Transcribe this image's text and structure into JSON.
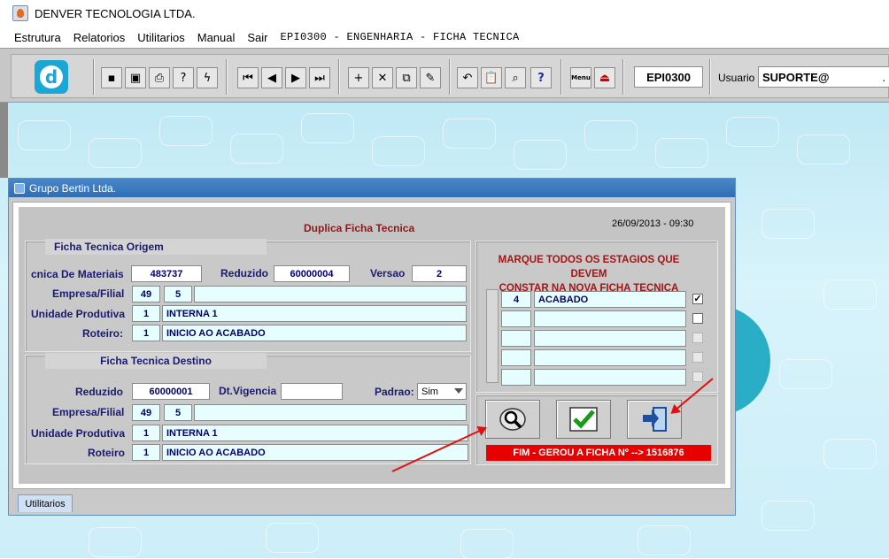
{
  "window": {
    "title": "DENVER TECNOLOGIA LTDA."
  },
  "menu": {
    "items": [
      "Estrutura",
      "Relatorios",
      "Utilitarios",
      "Manual",
      "Sair"
    ],
    "form_caption": "EPI0300 - ENGENHARIA - FICHA TECNICA"
  },
  "toolbar": {
    "form_code": "EPI0300",
    "user_label": "Usuario",
    "user_value": "SUPORTE@",
    "user_suffix": ".",
    "menu_icon_label": "Menu"
  },
  "inner_window": {
    "title": "Grupo Bertin Ltda.",
    "tab_label": "Utilitarios"
  },
  "form": {
    "heading": "Duplica Ficha Tecnica",
    "datetime": "26/09/2013 - 09:30",
    "origem": {
      "title": "Ficha Tecnica Origem",
      "lbl_materiais": "cnica De Materiais",
      "materiais": "483737",
      "lbl_reduzido": "Reduzido",
      "reduzido": "60000004",
      "lbl_versao": "Versao",
      "versao": "2",
      "lbl_empresa": "Empresa/Filial",
      "empresa": "49",
      "filial": "5",
      "empresa_desc": "",
      "lbl_unidade": "Unidade Produtiva",
      "unidade": "1",
      "unidade_desc": "INTERNA 1",
      "lbl_roteiro": "Roteiro:",
      "roteiro": "1",
      "roteiro_desc": "INICIO AO ACABADO"
    },
    "destino": {
      "title": "Ficha Tecnica Destino",
      "lbl_reduzido": "Reduzido",
      "reduzido": "60000001",
      "lbl_vigencia": "Dt.Vigencia",
      "vigencia": "",
      "lbl_padrao": "Padrao:",
      "padrao": "Sim",
      "lbl_empresa": "Empresa/Filial",
      "empresa": "49",
      "filial": "5",
      "empresa_desc": "",
      "lbl_unidade": "Unidade Produtiva",
      "unidade": "1",
      "unidade_desc": "INTERNA 1",
      "lbl_roteiro": "Roteiro",
      "roteiro": "1",
      "roteiro_desc": "INICIO AO ACABADO"
    },
    "estagios": {
      "instruction_line1": "MARQUE TODOS OS ESTAGIOS QUE DEVEM",
      "instruction_line2": "CONSTAR NA NOVA FICHA TECNICA",
      "rows": [
        {
          "code": "4",
          "desc": "ACABADO",
          "checked": true
        },
        {
          "code": "",
          "desc": "",
          "checked": false
        },
        {
          "code": "",
          "desc": "",
          "checked": false
        },
        {
          "code": "",
          "desc": "",
          "checked": false
        },
        {
          "code": "",
          "desc": "",
          "checked": false
        }
      ]
    },
    "status_message": "FIM - GEROU A FICHA Nº --> 1516876"
  },
  "colors": {
    "accent": "#2f6eb5",
    "field_bg": "#e6feff",
    "status_bg": "#e60000",
    "heading": "#8b1a1a"
  }
}
